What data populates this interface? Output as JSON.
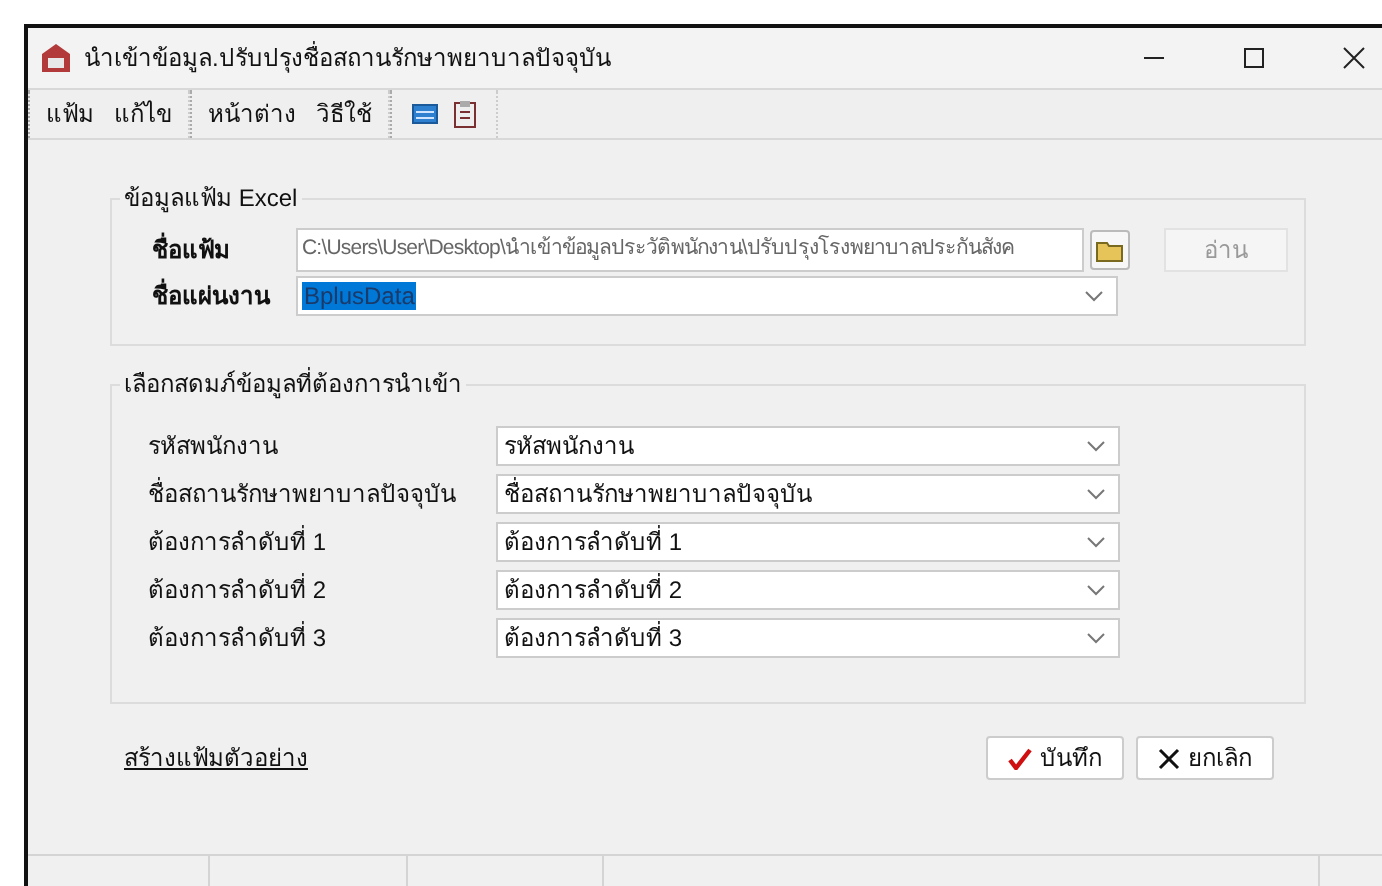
{
  "window": {
    "title": "นำเข้าข้อมูล.ปรับปรุงชื่อสถานรักษาพยาบาลปัจจุบัน"
  },
  "menu": [
    [
      "แฟ้ม",
      "แก้ไข"
    ],
    [
      "หน้าต่าง",
      "วิธีใช้"
    ]
  ],
  "excel_group": {
    "title": "ข้อมูลแฟ้ม Excel",
    "file_label": "ชื่อแฟ้ม",
    "file_value": "C:\\Users\\User\\Desktop\\นำเข้าข้อมูลประวัติพนักงาน\\ปรับปรุงโรงพยาบาลประกันสังค",
    "read_button": {
      "label": "อ่าน",
      "disabled": true
    },
    "sheet_label": "ชื่อแผ่นงาน",
    "sheet_value": "BplusData",
    "sheet_selected": true
  },
  "columns_group": {
    "title": "เลือกสดมภ์ข้อมูลที่ต้องการนำเข้า",
    "rows": [
      {
        "label": "รหัสพนักงาน",
        "value": "รหัสพนักงาน"
      },
      {
        "label": "ชื่อสถานรักษาพยาบาลปัจจุบัน",
        "value": "ชื่อสถานรักษาพยาบาลปัจจุบัน"
      },
      {
        "label": "ต้องการลำดับที่ 1",
        "value": "ต้องการลำดับที่ 1"
      },
      {
        "label": "ต้องการลำดับที่ 2",
        "value": "ต้องการลำดับที่ 2"
      },
      {
        "label": "ต้องการลำดับที่ 3",
        "value": "ต้องการลำดับที่ 3"
      }
    ]
  },
  "sample_link": "สร้างแฟ้มตัวอย่าง",
  "buttons": [
    {
      "label": "บันทึก",
      "kind": "save"
    },
    {
      "label": "ยกเลิก",
      "kind": "cancel"
    }
  ]
}
